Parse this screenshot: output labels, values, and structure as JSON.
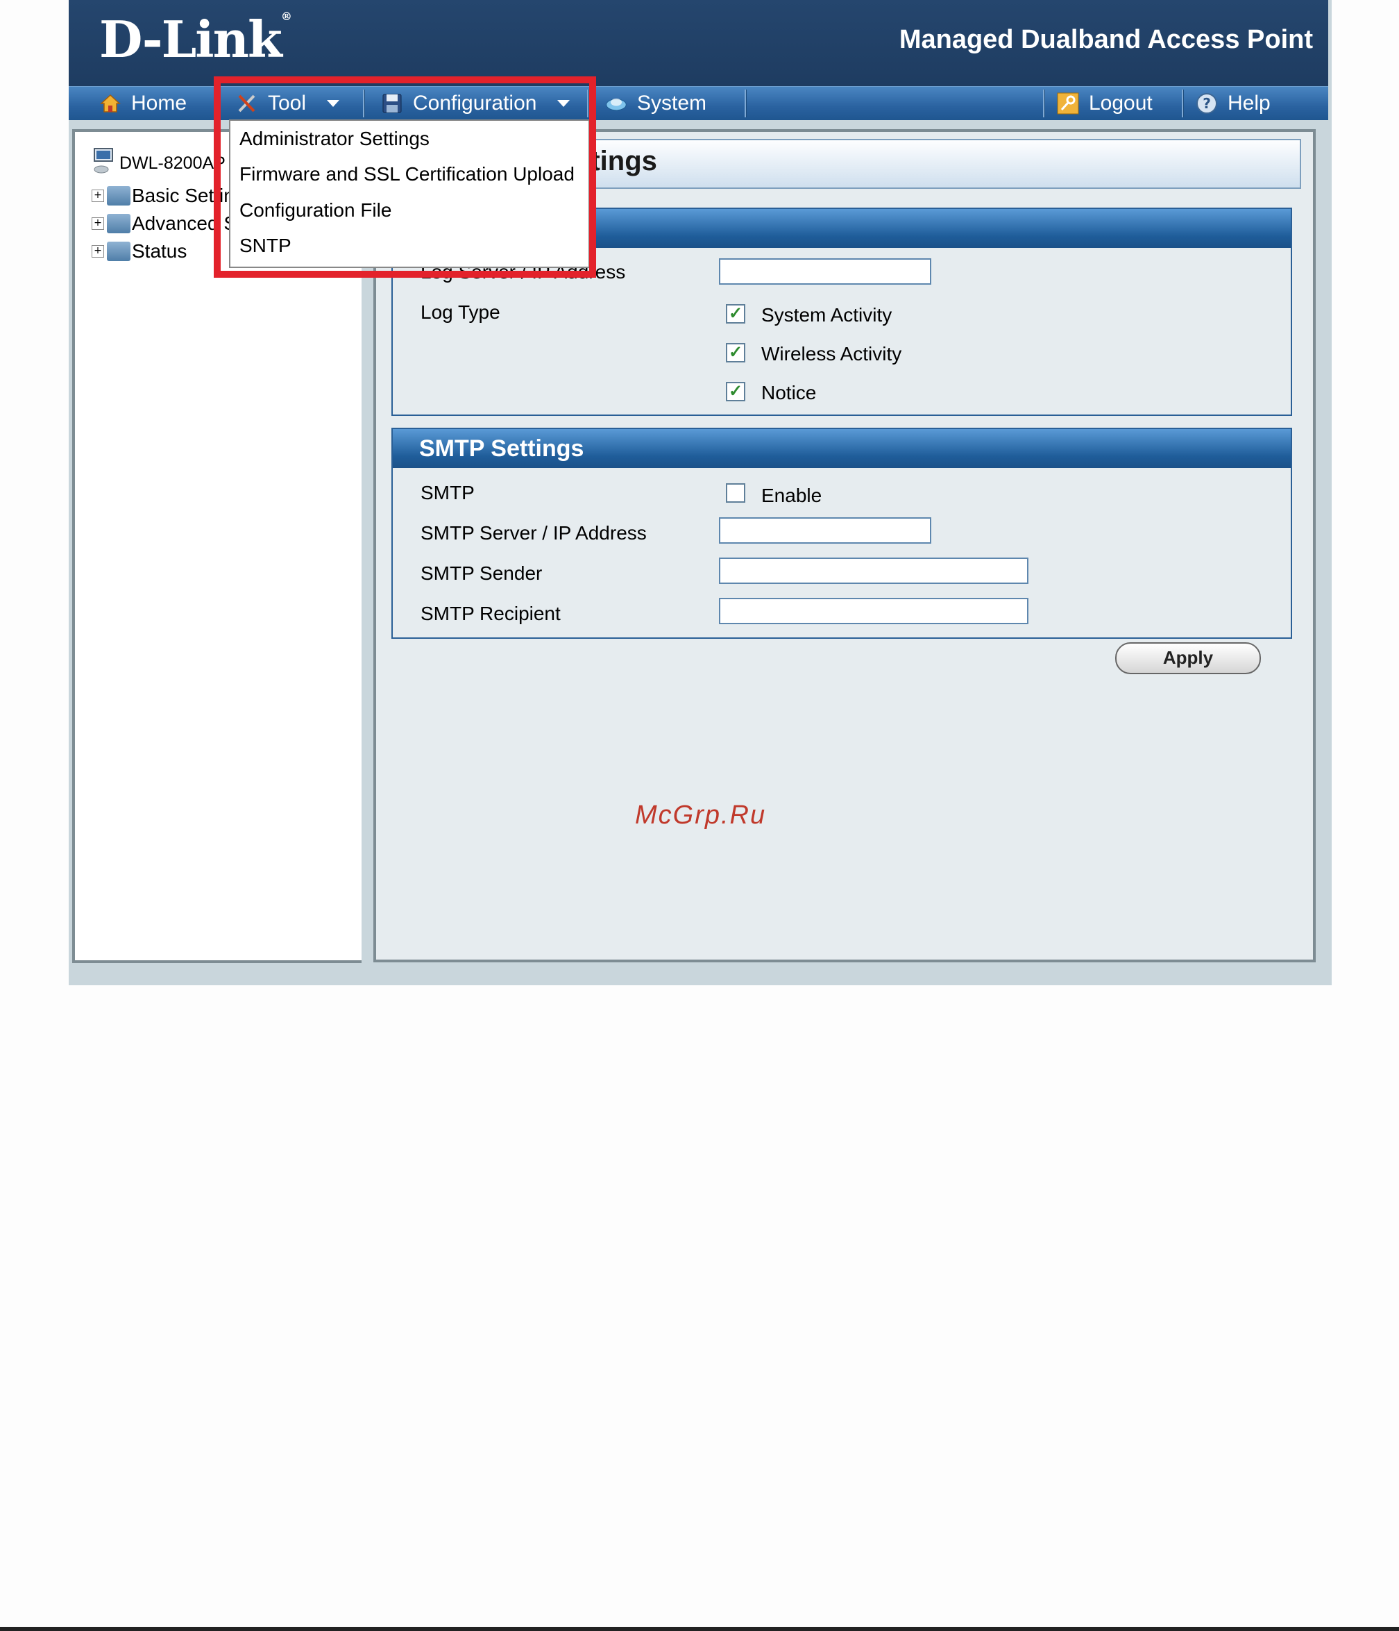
{
  "brand": "D-Link",
  "product": "Managed Dualband Access Point",
  "nav": {
    "home": "Home",
    "tool": "Tool",
    "configuration": "Configuration",
    "system": "System",
    "logout": "Logout",
    "help": "Help"
  },
  "tool_menu": [
    "Administrator Settings",
    "Firmware and SSL Certification Upload",
    "Configuration File",
    "SNTP"
  ],
  "tree": {
    "device": "DWL-8200AP",
    "items": [
      "Basic Settings",
      "Advanced Settings",
      "Status"
    ]
  },
  "page_title": "Log Settings",
  "log": {
    "server_label": "Log Server / IP Address",
    "server_value": "",
    "type_label": "Log Type",
    "types": [
      {
        "label": "System Activity",
        "checked": true
      },
      {
        "label": "Wireless Activity",
        "checked": true
      },
      {
        "label": "Notice",
        "checked": true
      }
    ]
  },
  "smtp": {
    "header": "SMTP Settings",
    "smtp_label": "SMTP",
    "enable_label": "Enable",
    "enable_checked": false,
    "server_label": "SMTP Server / IP Address",
    "sender_label": "SMTP Sender",
    "recipient_label": "SMTP Recipient",
    "server_value": "",
    "sender_value": "",
    "recipient_value": ""
  },
  "apply_label": "Apply",
  "watermark": "McGrp.Ru",
  "colors": {
    "header": "#1e3c61",
    "navbar": "#2a62a0",
    "highlight": "#e3222b",
    "panel_border": "#2a5f96"
  }
}
